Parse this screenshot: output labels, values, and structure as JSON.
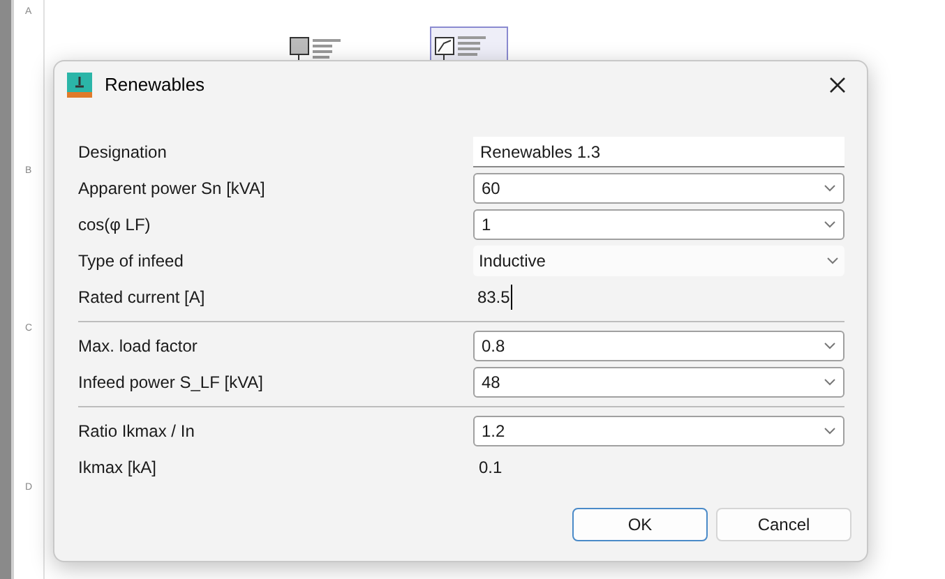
{
  "sheet": {
    "row_markers": [
      "A",
      "B",
      "C",
      "D"
    ]
  },
  "dialog": {
    "title": "Renewables",
    "groups": [
      {
        "rows": [
          {
            "label": "Designation",
            "kind": "input",
            "value": "Renewables 1.3"
          },
          {
            "label": "Apparent power Sn [kVA]",
            "kind": "combo",
            "value": "60"
          },
          {
            "label": "cos(φ LF)",
            "kind": "combo",
            "value": "1"
          },
          {
            "label": "Type of infeed",
            "kind": "flat-combo",
            "value": "Inductive"
          },
          {
            "label": "Rated current [A]",
            "kind": "edit-text",
            "value": "83.5"
          }
        ]
      },
      {
        "rows": [
          {
            "label": "Max. load factor",
            "kind": "combo",
            "value": "0.8"
          },
          {
            "label": "Infeed power S_LF [kVA]",
            "kind": "combo",
            "value": "48"
          }
        ]
      },
      {
        "rows": [
          {
            "label": "Ratio Ikmax / In",
            "kind": "combo",
            "value": "1.2"
          },
          {
            "label": "Ikmax [kA]",
            "kind": "readout",
            "value": "0.1"
          }
        ]
      }
    ],
    "buttons": [
      {
        "label": "OK",
        "default": true
      },
      {
        "label": "Cancel",
        "default": false
      }
    ]
  }
}
